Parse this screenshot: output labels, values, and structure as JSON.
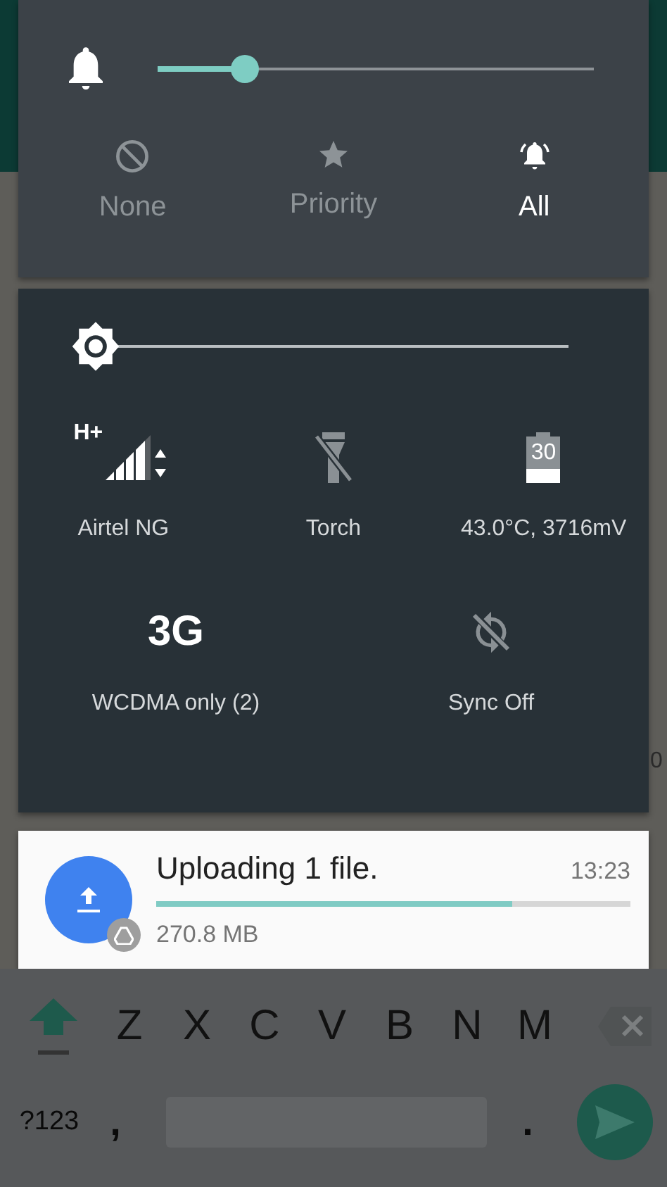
{
  "volume": {
    "level": 0.2
  },
  "zen_modes": [
    {
      "label": "None",
      "kind": "none",
      "selected": false
    },
    {
      "label": "Priority",
      "kind": "priority",
      "selected": false
    },
    {
      "label": "All",
      "kind": "all",
      "selected": true
    }
  ],
  "brightness": {
    "level": 0
  },
  "tiles": [
    {
      "label": "Airtel NG",
      "kind": "cellular",
      "network": "H+",
      "on": true
    },
    {
      "label": "Torch",
      "kind": "torch",
      "on": false
    },
    {
      "label": "43.0°C, 3716mV",
      "kind": "battery",
      "battery_text": "30",
      "on": true
    },
    {
      "label": "WCDMA only (2)",
      "kind": "network-mode",
      "badge": "3G",
      "on": true
    },
    {
      "label": "Sync Off",
      "kind": "sync",
      "on": false
    }
  ],
  "notification": {
    "title": "Uploading 1 file.",
    "time": "13:23",
    "level": 0.75,
    "detail": "270.8 MB"
  },
  "background_text": "0",
  "keyboard": {
    "letters": [
      "Z",
      "X",
      "C",
      "V",
      "B",
      "N",
      "M"
    ],
    "symbols_key": "?123",
    "comma": ",",
    "period": "."
  }
}
